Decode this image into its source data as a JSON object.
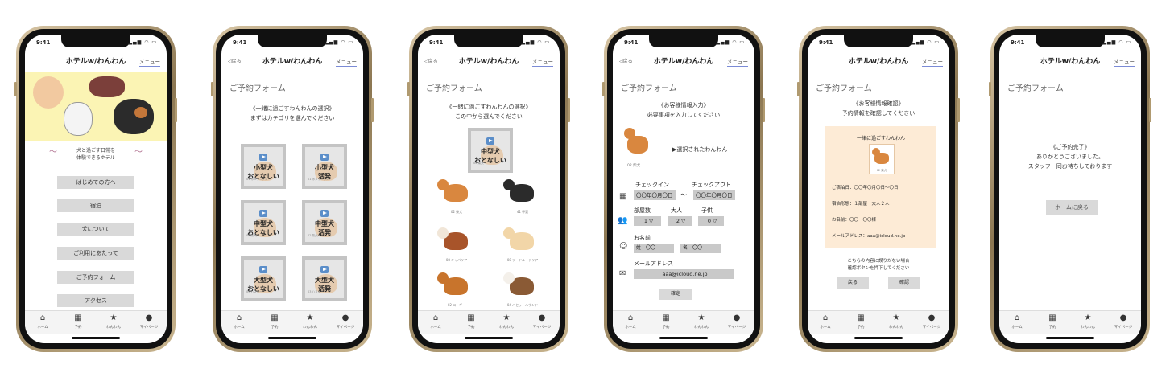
{
  "status_time": "9:41",
  "header_title": "ホテルw/わんわん",
  "menu_label": "メニュー",
  "back_label": "◁戻る",
  "tabs": [
    {
      "icon": "home-icon",
      "label": "ホーム"
    },
    {
      "icon": "calendar-icon",
      "label": "予約"
    },
    {
      "icon": "star-icon",
      "label": "わんわん"
    },
    {
      "icon": "person-icon",
      "label": "マイページ"
    }
  ],
  "screen1": {
    "tagline_line1": "犬と過ごす日常を",
    "tagline_line2": "体験できるホテル",
    "buttons": [
      "はじめての方へ",
      "宿泊",
      "犬について",
      "ご利用にあたって",
      "ご予約フォーム",
      "アクセス"
    ]
  },
  "screen2": {
    "heading": "ご予約フォーム",
    "intro_line1": "《一緒に過ごすわんわんの選択》",
    "intro_line2": "まずはカテゴリを選んでください",
    "tiles": [
      {
        "text": "小型犬\nおとなしい",
        "caption": "01 ポメラニアン"
      },
      {
        "text": "小型犬\n活発",
        "caption": "01 ポメラニアン"
      },
      {
        "text": "中型犬\nおとなしい",
        "caption": "02 柴犬"
      },
      {
        "text": "中型犬\n活発",
        "caption": "02 柴犬"
      },
      {
        "text": "大型犬\nおとなしい",
        "caption": "03 ハスキー"
      },
      {
        "text": "大型犬\n活発",
        "caption": "03 ハスキー"
      }
    ]
  },
  "screen3": {
    "heading": "ご予約フォーム",
    "intro_line1": "《一緒に過ごすわんわんの選択》",
    "intro_line2": "この中から選んでください",
    "selected_tile": {
      "text": "中型犬\nおとなしい",
      "caption": "02 柴犬"
    },
    "dogs": [
      {
        "caption": "02 柴犬",
        "color": "#d9873f"
      },
      {
        "caption": "41 甲斐",
        "color": "#2b2b2b"
      },
      {
        "caption": "08 キャバリア",
        "color": "#a8542a"
      },
      {
        "caption": "08 プードル・テリア",
        "color": "#f2d6a8"
      },
      {
        "caption": "02 コーギー",
        "color": "#c8742c"
      },
      {
        "caption": "04 バセットハウンド",
        "color": "#8a5a35"
      }
    ]
  },
  "screen4": {
    "heading": "ご予約フォーム",
    "intro_line1": "《お客様情報入力》",
    "intro_line2": "必要事項を入力してください",
    "dog_caption": "02 柴犬",
    "selected_label": "▶選択されたわんわん",
    "checkin_label": "チェックイン",
    "checkout_label": "チェックアウト",
    "checkin_value": "〇〇年〇月〇日",
    "checkout_value": "〇〇年〇月〇日",
    "tilde": "～",
    "rooms_label": "部屋数",
    "adults_label": "大人",
    "children_label": "子供",
    "rooms_value": "1",
    "adults_value": "2",
    "children_value": "0",
    "name_label": "お名前",
    "last_name": "姓　〇〇",
    "first_name": "名　〇〇",
    "email_label": "メールアドレス",
    "email_value": "aaa@icloud.ne.jp",
    "confirm_button": "確定"
  },
  "screen5": {
    "heading": "ご予約フォーム",
    "intro_line1": "《お客様情報確認》",
    "intro_line2": "予約情報を確認してください",
    "card_title": "一緒に過ごすわんわん",
    "dog_caption": "02 柴犬",
    "stay_dates": "ご宿泊日：〇〇年〇月〇日〜〇日",
    "stay_type": "宿泊形態：１部屋　大人２人",
    "name_line": "お名前：〇〇　〇〇様",
    "email_line": "メールアドレス：aaa@icloud.ne.jp",
    "note_line1": "こちらの内容に誤りがない場合",
    "note_line2": "確認ボタンを押下してください",
    "back_button": "戻る",
    "confirm_button": "確認"
  },
  "screen6": {
    "heading": "ご予約フォーム",
    "line1": "《ご予約完了》",
    "line2": "ありがとうございました。",
    "line3": "スタッフ一同お待ちしております",
    "home_button": "ホームに戻る"
  }
}
